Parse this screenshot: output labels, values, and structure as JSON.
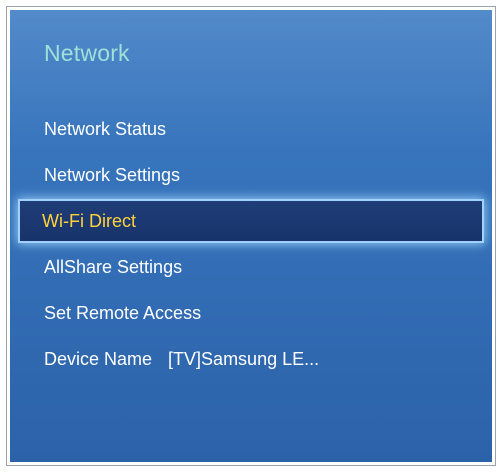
{
  "panel": {
    "title": "Network"
  },
  "menu": {
    "items": [
      {
        "label": "Network Status"
      },
      {
        "label": "Network Settings"
      },
      {
        "label": "Wi-Fi Direct"
      },
      {
        "label": "AllShare Settings"
      },
      {
        "label": "Set Remote Access"
      },
      {
        "label": "Device Name",
        "value": "[TV]Samsung LE..."
      }
    ],
    "selected_index": 2
  },
  "colors": {
    "panel_background": "#3572ba",
    "title_color": "#9fe0d9",
    "item_text": "#ffffff",
    "selected_text": "#ffd23c",
    "selected_background": "#1c3870",
    "selected_glow": "#9fd2ff"
  }
}
